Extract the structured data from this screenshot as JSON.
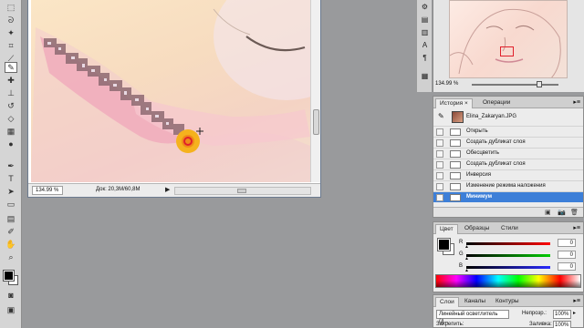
{
  "tools": [
    "marquee-icon",
    "lasso-icon",
    "magic-wand-icon",
    "crop-icon",
    "slice-icon",
    "healing-brush-icon",
    "brush-icon",
    "clone-stamp-icon",
    "history-brush-icon",
    "eraser-icon",
    "gradient-icon",
    "dodge-icon",
    "pen-icon",
    "type-icon",
    "path-select-icon",
    "shape-icon",
    "notes-icon",
    "eyedropper-icon",
    "hand-icon",
    "zoom-icon"
  ],
  "document": {
    "zoom": "134.99 %",
    "doc_info": "Док: 20,3M/60,8M",
    "status_arrow": "▶"
  },
  "midstrip": {
    "buttons": [
      "⚙",
      "▤",
      "▥",
      "A",
      "¶",
      "▦"
    ]
  },
  "navigator": {
    "zoom": "134.99 %"
  },
  "history": {
    "tabs": [
      "История",
      "Операции"
    ],
    "close": "×",
    "snapshot": "Elina_Zakaryan.JPG",
    "steps": [
      "Открыть",
      "Создать дубликат слоя",
      "Обесцветить",
      "Создать дубликат слоя",
      "Инверсия",
      "Изменение режима наложения",
      "Минимум"
    ],
    "selected_index": 6,
    "footer": [
      "▣",
      "📷",
      "🗑"
    ]
  },
  "color": {
    "tabs": [
      "Цвет",
      "Образцы",
      "Стили"
    ],
    "channels": [
      {
        "letter": "R",
        "value": "0",
        "bar": "#ff0000"
      },
      {
        "letter": "G",
        "value": "0",
        "bar": "#00cc00"
      },
      {
        "letter": "B",
        "value": "0",
        "bar": "#2a2aff"
      }
    ]
  },
  "layers": {
    "tabs": [
      "Слои",
      "Каналы",
      "Контуры"
    ],
    "blend_mode": "Линейный осветлитель (д...",
    "opacity_label": "Непрозр.:",
    "opacity_value": "100%",
    "lock_label": "Закрепить:",
    "fill_label": "Заливка:",
    "fill_value": "100%"
  }
}
